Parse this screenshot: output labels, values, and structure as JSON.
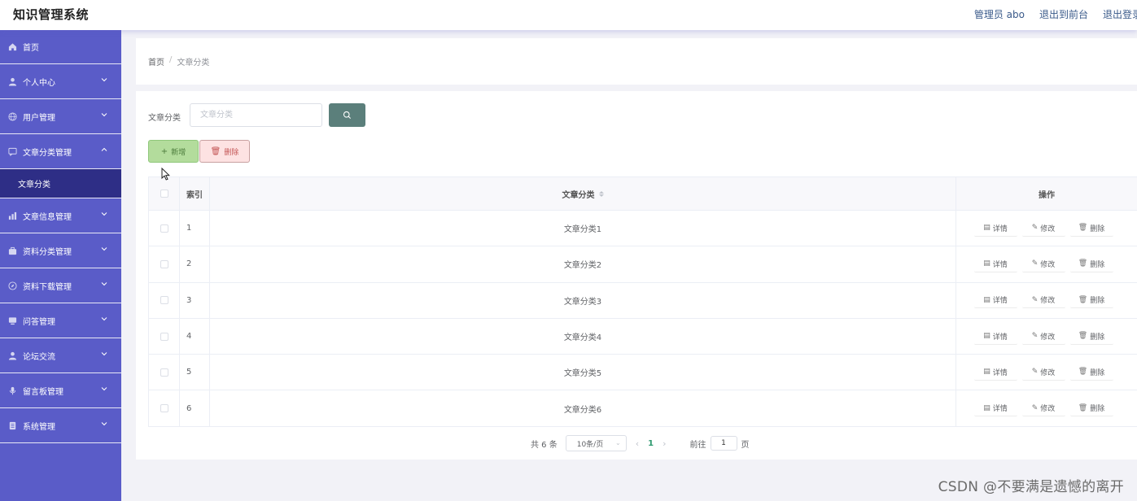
{
  "app": {
    "title": "知识管理系统"
  },
  "header": {
    "admin": "管理员 abo",
    "to_front": "退出到前台",
    "logout": "退出登录"
  },
  "sidebar": {
    "items": [
      {
        "label": "首页",
        "icon": "home-icon"
      },
      {
        "label": "个人中心",
        "icon": "user-icon"
      },
      {
        "label": "用户管理",
        "icon": "globe-icon"
      },
      {
        "label": "文章分类管理",
        "icon": "chat-icon"
      },
      {
        "label": "文章信息管理",
        "icon": "chart-icon"
      },
      {
        "label": "资料分类管理",
        "icon": "briefcase-icon"
      },
      {
        "label": "资料下载管理",
        "icon": "compass-icon"
      },
      {
        "label": "问答管理",
        "icon": "monitor-icon"
      },
      {
        "label": "论坛交流",
        "icon": "user-icon"
      },
      {
        "label": "留言板管理",
        "icon": "mic-icon"
      },
      {
        "label": "系统管理",
        "icon": "document-icon"
      }
    ],
    "active_sub": "文章分类"
  },
  "breadcrumb": {
    "home": "首页",
    "sep": "/",
    "current": "文章分类"
  },
  "search": {
    "label": "文章分类",
    "placeholder": "文章分类"
  },
  "toolbar": {
    "add_label": "新增",
    "delete_label": "删除"
  },
  "table": {
    "headers": {
      "index": "索引",
      "name": "文章分类",
      "ops": "操作"
    },
    "rows": [
      {
        "index": "1",
        "name": "文章分类1"
      },
      {
        "index": "2",
        "name": "文章分类2"
      },
      {
        "index": "3",
        "name": "文章分类3"
      },
      {
        "index": "4",
        "name": "文章分类4"
      },
      {
        "index": "5",
        "name": "文章分类5"
      },
      {
        "index": "6",
        "name": "文章分类6"
      }
    ],
    "ops": {
      "detail": "详情",
      "edit": "修改",
      "delete": "删除"
    }
  },
  "pagination": {
    "total": "共 6 条",
    "page_size": "10条/页",
    "current": "1",
    "goto_prefix": "前往",
    "goto_value": "1",
    "goto_suffix": "页"
  },
  "watermark": "CSDN @不要满是遗憾的离开",
  "colors": {
    "sidebar": "#5a5cc8",
    "submenu_active": "#2e2e86",
    "search_btn": "#5b7f7b",
    "add_btn": "#b3dc9c",
    "delete_btn": "#fde2e2"
  }
}
